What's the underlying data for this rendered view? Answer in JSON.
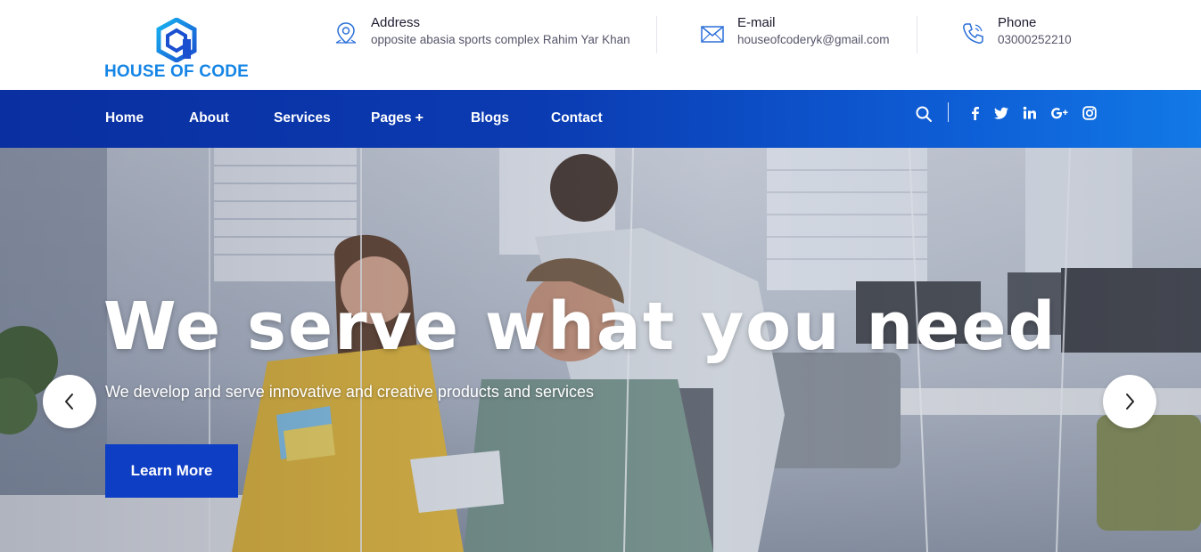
{
  "brand": {
    "name": "HOUSE OF CODE",
    "color": "#1585e6"
  },
  "contact": {
    "address": {
      "label": "Address",
      "value": "opposite abasia sports complex Rahim Yar Khan",
      "icon": "map-pin-icon"
    },
    "email": {
      "label": "E-mail",
      "value": "houseofcoderyk@gmail.com",
      "icon": "envelope-icon"
    },
    "phone": {
      "label": "Phone",
      "value": "03000252210",
      "icon": "phone-icon"
    }
  },
  "nav": {
    "items": [
      {
        "label": "Home"
      },
      {
        "label": "About"
      },
      {
        "label": "Services"
      },
      {
        "label": "Pages",
        "has_submenu": true,
        "submenu_glyph": "+"
      },
      {
        "label": "Blogs"
      },
      {
        "label": "Contact"
      }
    ],
    "search_icon": "search-icon",
    "social": [
      "facebook-icon",
      "twitter-icon",
      "linkedin-icon",
      "google-plus-icon",
      "instagram-icon"
    ],
    "gradient": [
      "#0a2fa0",
      "#1279e6"
    ]
  },
  "hero": {
    "title": "We serve what you need",
    "subtitle": "We develop and serve innovative and creative products and services",
    "cta_label": "Learn More",
    "cta_color": "#0e3ec4",
    "prev_icon": "chevron-left-icon",
    "next_icon": "chevron-right-icon"
  }
}
